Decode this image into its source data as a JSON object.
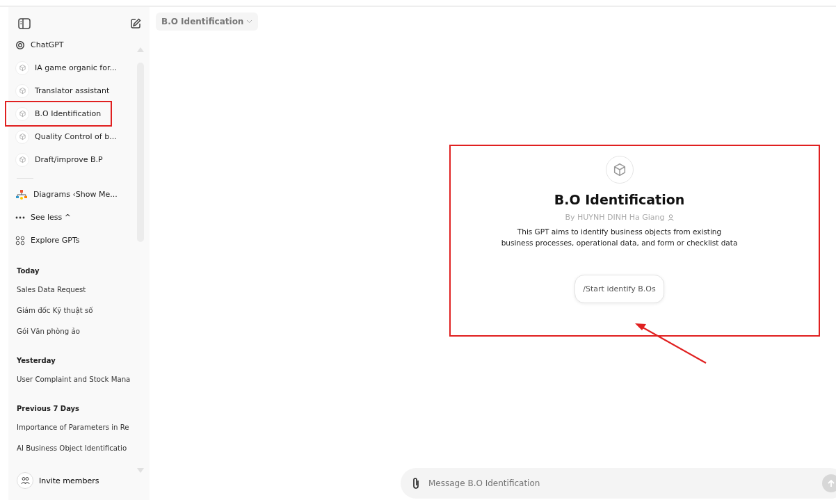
{
  "sidebar": {
    "gpts": [
      {
        "kind": "chatgpt",
        "label": "ChatGPT",
        "annotated": false
      },
      {
        "kind": "gpt",
        "label": "IA game organic for...",
        "annotated": false
      },
      {
        "kind": "gpt",
        "label": "Translator assistant",
        "annotated": false
      },
      {
        "kind": "gpt",
        "label": "B.O Identification",
        "annotated": true
      },
      {
        "kind": "gpt",
        "label": "Quality Control of b...",
        "annotated": false
      },
      {
        "kind": "gpt",
        "label": "Draft/improve B.P",
        "annotated": false
      }
    ],
    "more": [
      {
        "kind": "diagram",
        "label": "Diagrams ‹Show Me..."
      },
      {
        "kind": "less",
        "label": "See less ^"
      },
      {
        "kind": "explore",
        "label": "Explore GPTs"
      }
    ],
    "history": [
      {
        "heading": "Today",
        "items": [
          "Sales Data Request",
          "Giám đốc Kỹ thuật số",
          "Gói Văn phòng ảo"
        ]
      },
      {
        "heading": "Yesterday",
        "items": [
          "User Complaint and Stock Mana"
        ]
      },
      {
        "heading": "Previous 7 Days",
        "items": [
          "Importance of Parameters in Re",
          "AI Business Object Identificatio"
        ]
      }
    ],
    "footer": "Invite members"
  },
  "header": {
    "model": "B.O Identification"
  },
  "gpt": {
    "title": "B.O Identification",
    "author": "By HUYNH DINH Ha Giang",
    "description": "This GPT aims to identify business objects from existing business processes, operational data, and form or checklist data",
    "starter": "/Start identify B.Os"
  },
  "composer": {
    "placeholder": "Message B.O Identification"
  }
}
